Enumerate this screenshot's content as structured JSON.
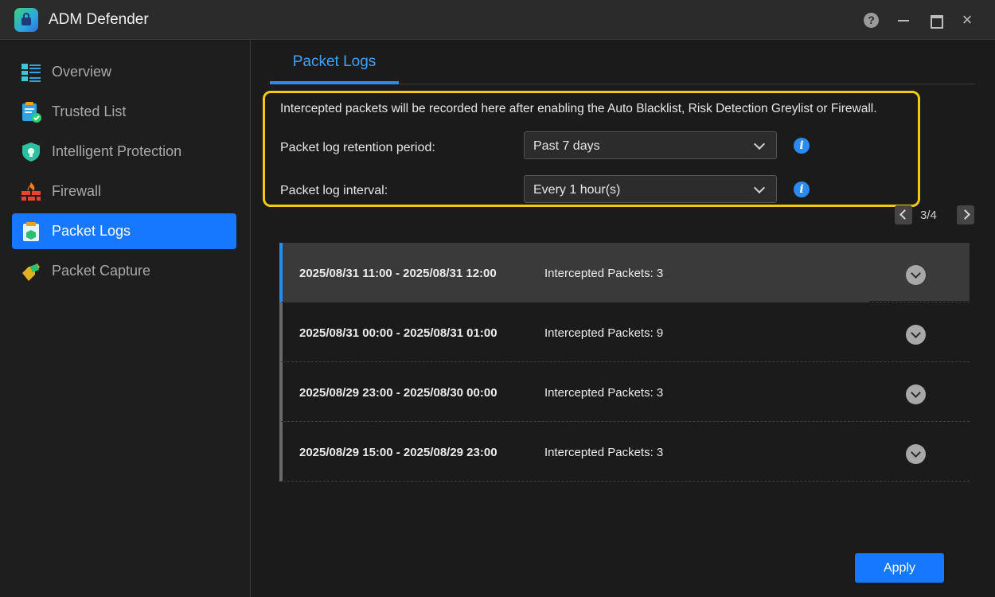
{
  "window": {
    "title": "ADM Defender",
    "help_label": "?"
  },
  "sidebar": {
    "items": [
      {
        "label": "Overview",
        "icon": "overview-icon"
      },
      {
        "label": "Trusted List",
        "icon": "trusted-list-icon"
      },
      {
        "label": "Intelligent Protection",
        "icon": "intelligent-protection-icon"
      },
      {
        "label": "Firewall",
        "icon": "firewall-icon"
      },
      {
        "label": "Packet Logs",
        "icon": "packet-logs-icon",
        "active": true
      },
      {
        "label": "Packet Capture",
        "icon": "packet-capture-icon"
      }
    ]
  },
  "main": {
    "tabs": [
      {
        "label": "Packet Logs",
        "active": true
      }
    ],
    "intro": "Intercepted packets will be recorded here after enabling the Auto Blacklist, Risk Detection Greylist or Firewall.",
    "retention": {
      "label": "Packet log retention period:",
      "value": "Past 7 days"
    },
    "interval": {
      "label": "Packet log interval:",
      "value": "Every 1 hour(s)"
    },
    "info_glyph": "i",
    "pager": {
      "text": "3/4"
    },
    "logs": [
      {
        "range": "2025/08/31 11:00 - 2025/08/31 12:00",
        "count": "Intercepted Packets: 3"
      },
      {
        "range": "2025/08/31 00:00 - 2025/08/31 01:00",
        "count": "Intercepted Packets: 9"
      },
      {
        "range": "2025/08/29 23:00 - 2025/08/30 00:00",
        "count": "Intercepted Packets: 3"
      },
      {
        "range": "2025/08/29 15:00 - 2025/08/29 23:00",
        "count": "Intercepted Packets: 3"
      }
    ],
    "apply_label": "Apply"
  },
  "colors": {
    "accent": "#1677ff",
    "tab_accent": "#3da3ff",
    "highlight_border": "#f2cc0c"
  }
}
